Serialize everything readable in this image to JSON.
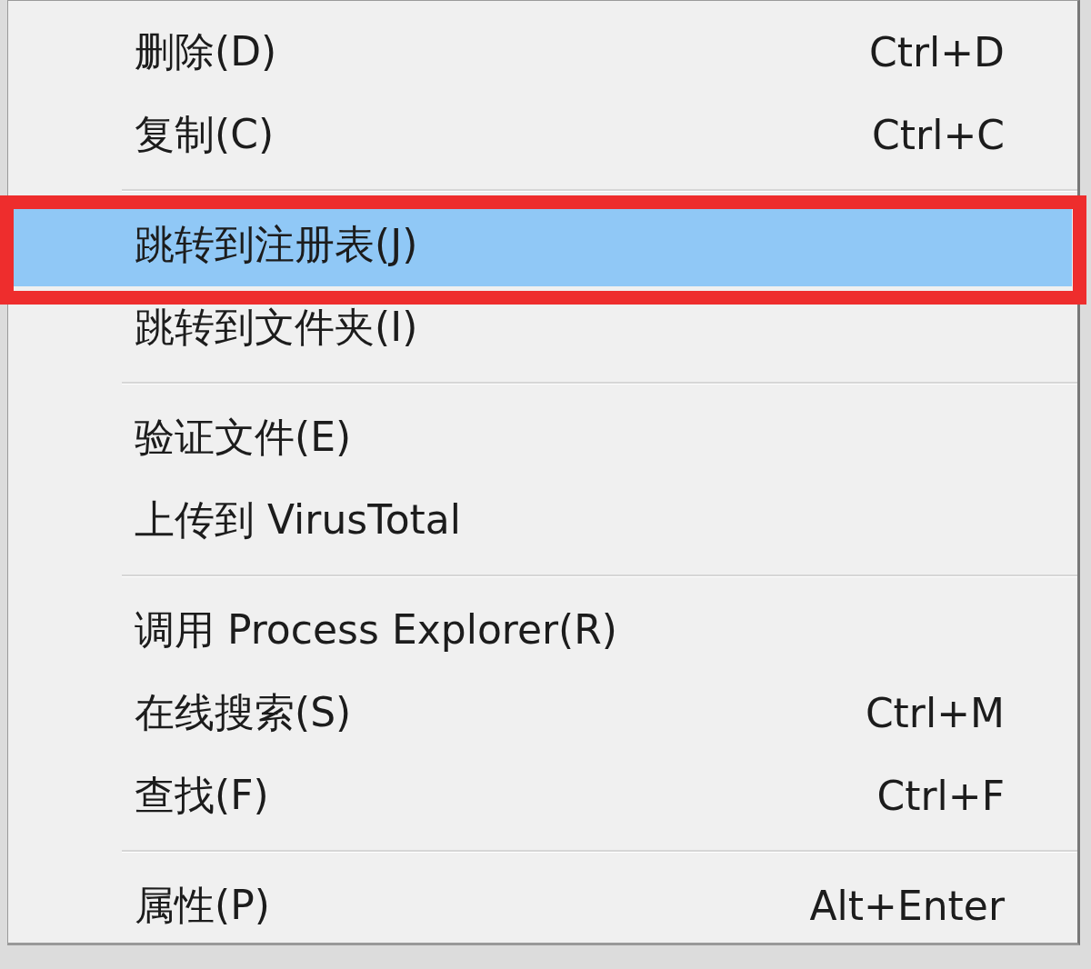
{
  "context_menu": {
    "items": [
      {
        "kind": "item",
        "label": "删除(D)",
        "shortcut": "Ctrl+D",
        "selected": false,
        "annotated": false
      },
      {
        "kind": "item",
        "label": "复制(C)",
        "shortcut": "Ctrl+C",
        "selected": false,
        "annotated": false
      },
      {
        "kind": "separator"
      },
      {
        "kind": "item",
        "label": "跳转到注册表(J)",
        "selected": true,
        "annotated": true
      },
      {
        "kind": "item",
        "label": "跳转到文件夹(I)",
        "selected": false,
        "annotated": false
      },
      {
        "kind": "separator"
      },
      {
        "kind": "item",
        "label": "验证文件(E)",
        "selected": false,
        "annotated": false
      },
      {
        "kind": "item",
        "label": "上传到 VirusTotal",
        "selected": false,
        "annotated": false
      },
      {
        "kind": "separator"
      },
      {
        "kind": "item",
        "label": "调用 Process Explorer(R)",
        "selected": false,
        "annotated": false
      },
      {
        "kind": "item",
        "label": "在线搜索(S)",
        "shortcut": "Ctrl+M",
        "selected": false,
        "annotated": false
      },
      {
        "kind": "item",
        "label": "查找(F)",
        "shortcut": "Ctrl+F",
        "selected": false,
        "annotated": false
      },
      {
        "kind": "separator"
      },
      {
        "kind": "item",
        "label": "属性(P)",
        "shortcut": "Alt+Enter",
        "selected": false,
        "annotated": false
      }
    ]
  }
}
